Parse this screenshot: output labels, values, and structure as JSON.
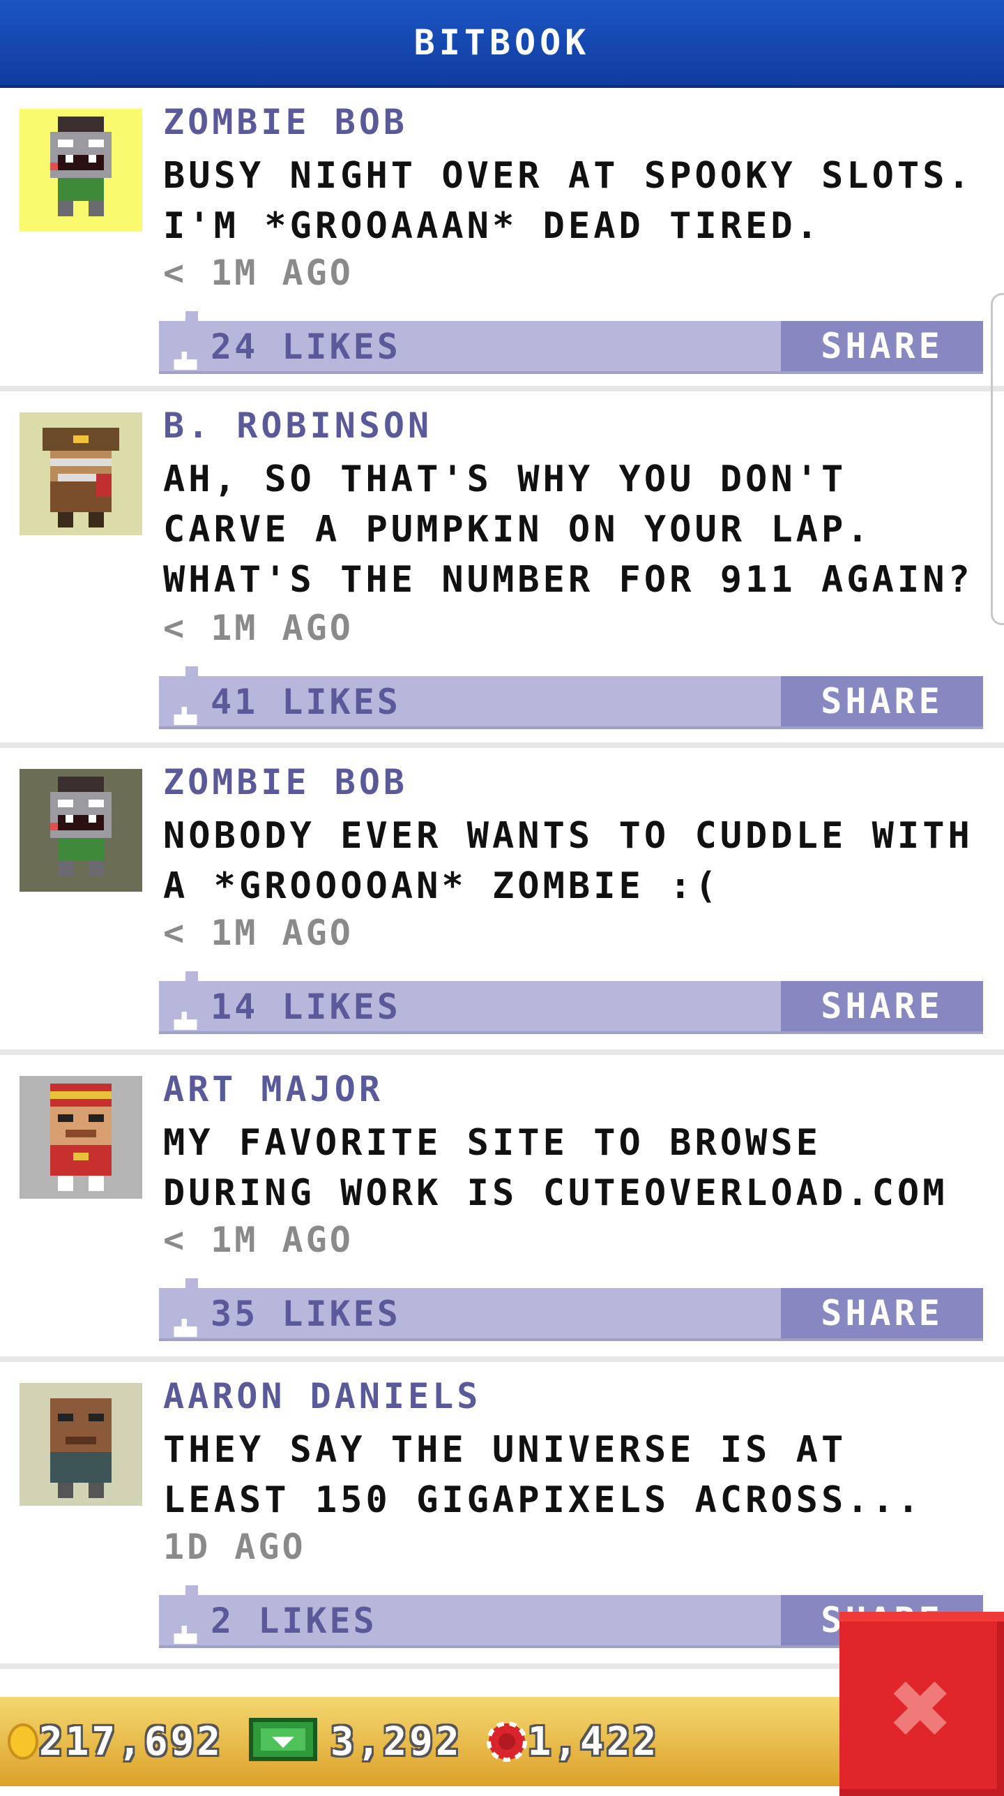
{
  "header": {
    "title": "BITBOOK"
  },
  "posts": [
    {
      "author": "ZOMBIE BOB",
      "text": "BUSY NIGHT OVER AT SPOOKY SLOTS. I'M *GROOAAAN* DEAD TIRED.",
      "time": "< 1M AGO",
      "likes": "24 LIKES",
      "share": "SHARE",
      "avatar_bg": "#fafa6e",
      "avatar_icon": "zombie-avatar-icon"
    },
    {
      "author": "B. ROBINSON",
      "text": "AH, SO THAT'S WHY YOU DON'T CARVE A PUMPKIN ON YOUR LAP. WHAT'S THE NUMBER FOR 911 AGAIN?",
      "time": "< 1M AGO",
      "likes": "41 LIKES",
      "share": "SHARE",
      "avatar_bg": "#dcdcaa",
      "avatar_icon": "detective-avatar-icon"
    },
    {
      "author": "ZOMBIE BOB",
      "text": "NOBODY EVER WANTS TO CUDDLE WITH A *GROOOOAN* ZOMBIE :(",
      "time": "< 1M AGO",
      "likes": "14 LIKES",
      "share": "SHARE",
      "avatar_bg": "#6b6e55",
      "avatar_icon": "zombie-avatar-icon"
    },
    {
      "author": "ART MAJOR",
      "text": "MY FAVORITE SITE TO BROWSE DURING WORK IS CUTEOVERLOAD.COM",
      "time": "< 1M AGO",
      "likes": "35 LIKES",
      "share": "SHARE",
      "avatar_bg": "#b4b4b4",
      "avatar_icon": "bellhop-avatar-icon"
    },
    {
      "author": "AARON DANIELS",
      "text": "THEY SAY THE UNIVERSE IS AT LEAST 150 GIGAPIXELS ACROSS...",
      "time": "1D AGO",
      "likes": "2 LIKES",
      "share": "SHARE",
      "avatar_bg": "#d2d2b4",
      "avatar_icon": "person-avatar-icon"
    }
  ],
  "currency": {
    "coins": "217,692",
    "bux": "3,292",
    "chips": "1,422"
  },
  "colors": {
    "header": "#1c55c4",
    "author": "#5a5a9a",
    "likebar": "#b6b7da",
    "share": "#8788c2",
    "bottombar": "#e8b84a",
    "close": "#e0262b"
  },
  "close_icon": "close-x-icon"
}
